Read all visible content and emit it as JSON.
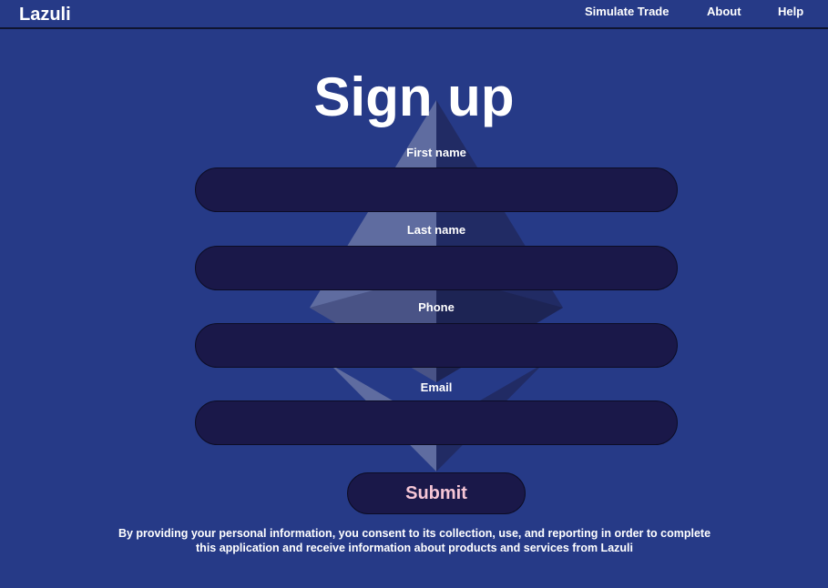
{
  "nav": {
    "logo": "Lazuli",
    "links": [
      "Simulate Trade",
      "About",
      "Help"
    ]
  },
  "form": {
    "title": "Sign up",
    "fields": [
      {
        "label": "First name",
        "value": "",
        "placeholder": ""
      },
      {
        "label": "Last name",
        "value": "",
        "placeholder": ""
      },
      {
        "label": "Phone",
        "value": "",
        "placeholder": ""
      },
      {
        "label": "Email",
        "value": "",
        "placeholder": ""
      }
    ],
    "submit_label": "Submit",
    "disclaimer_line1": "By providing your personal information, you consent to its collection, use, and reporting in order to complete",
    "disclaimer_line2": "this application and receive information about products and services from Lazuli"
  },
  "background_icon": "ethereum-logo-icon",
  "colors": {
    "background": "#263a87",
    "input_fill": "#1a1849",
    "submit_text": "#f6c6d6"
  }
}
